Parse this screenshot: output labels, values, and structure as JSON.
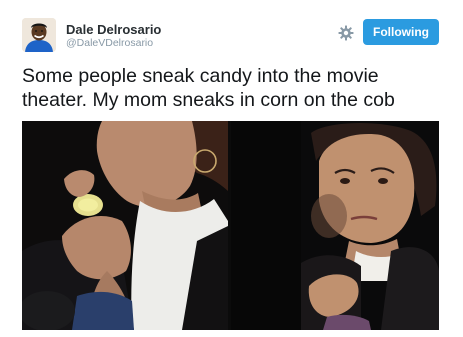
{
  "author": {
    "display_name": "Dale Delrosario",
    "handle": "@DaleVDelrosario",
    "avatar_icon": "person-avatar"
  },
  "actions": {
    "settings_icon": "gear-icon",
    "follow_label": "Following"
  },
  "tweet": {
    "text": "Some people sneak candy into the movie theater. My mom sneaks in corn on the cob"
  },
  "colors": {
    "follow_button": "#2b9be0",
    "name_text": "#292f33",
    "handle_text": "#8899a6",
    "tweet_text": "#14171a"
  },
  "media": {
    "photos": [
      {
        "subject": "woman eating corn on the cob in dark theater"
      },
      {
        "subject": "woman looking at camera holding corn in dark theater"
      }
    ]
  }
}
